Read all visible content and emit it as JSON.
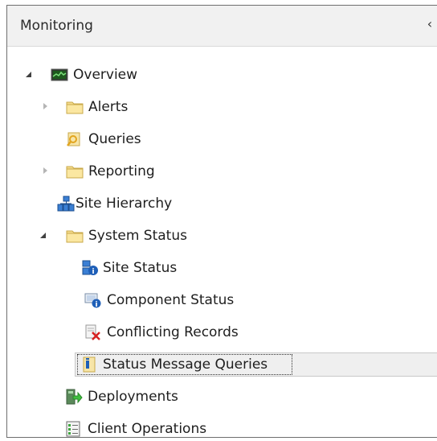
{
  "panel": {
    "title": "Monitoring",
    "collapse_glyph": "‹"
  },
  "tree": {
    "items": [
      {
        "label": "Overview",
        "icon": "overview-monitor-icon",
        "expander": "expanded",
        "level": 0
      },
      {
        "label": "Alerts",
        "icon": "folder-icon",
        "expander": "collapsed",
        "level": 1
      },
      {
        "label": "Queries",
        "icon": "queries-icon",
        "expander": "none",
        "level": 1
      },
      {
        "label": "Reporting",
        "icon": "folder-icon",
        "expander": "collapsed",
        "level": 1
      },
      {
        "label": "Site Hierarchy",
        "icon": "site-hierarchy-icon",
        "expander": "none",
        "level": 1
      },
      {
        "label": "System Status",
        "icon": "folder-icon",
        "expander": "expanded",
        "level": 1
      },
      {
        "label": "Site Status",
        "icon": "site-status-icon",
        "expander": "none",
        "level": 2
      },
      {
        "label": "Component Status",
        "icon": "component-status-icon",
        "expander": "none",
        "level": 2
      },
      {
        "label": "Conflicting Records",
        "icon": "conflicting-records-icon",
        "expander": "none",
        "level": 2
      },
      {
        "label": "Status Message Queries",
        "icon": "status-message-queries-icon",
        "expander": "none",
        "level": 2,
        "selected": true
      },
      {
        "label": "Deployments",
        "icon": "deployments-icon",
        "expander": "none",
        "level": 1
      },
      {
        "label": "Client Operations",
        "icon": "client-operations-icon",
        "expander": "none",
        "level": 1
      }
    ]
  }
}
